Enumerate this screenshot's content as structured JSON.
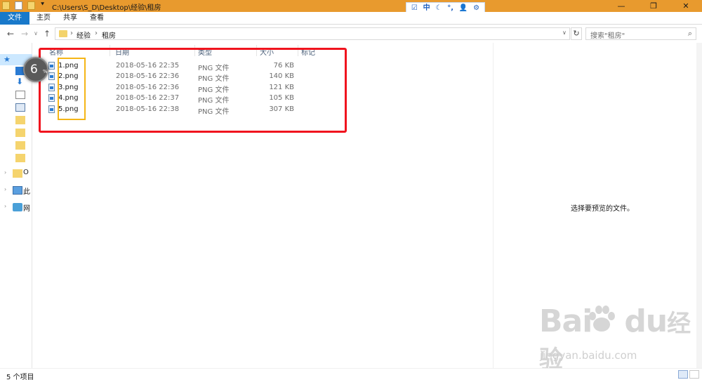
{
  "window": {
    "title": "C:\\Users\\S_D\\Desktop\\经验\\租房",
    "controls": {
      "minimize": "—",
      "restore": "❐",
      "close": "✕"
    }
  },
  "ime": {
    "items": [
      "☑",
      "中",
      "☾",
      "°,",
      "👤",
      "⚙"
    ]
  },
  "ribbon": {
    "tabs": [
      "文件",
      "主页",
      "共享",
      "查看"
    ]
  },
  "nav": {
    "back": "←",
    "forward": "→",
    "dropdown": "∨",
    "up": "↑",
    "breadcrumb": [
      "经验",
      "租房"
    ],
    "separator": "›",
    "address_dropdown": "∨",
    "refresh": "↻",
    "search_placeholder": "搜索\"租房\"",
    "search_icon": "⌕"
  },
  "navpane": {
    "labels": [
      "O",
      "此",
      "网"
    ]
  },
  "columns": [
    "名称",
    "日期",
    "类型",
    "大小",
    "标记"
  ],
  "files": [
    {
      "name": "1.png",
      "date": "2018-05-16 22:35",
      "type": "PNG 文件",
      "size": "76 KB"
    },
    {
      "name": "2.png",
      "date": "2018-05-16 22:36",
      "type": "PNG 文件",
      "size": "140 KB"
    },
    {
      "name": "3.png",
      "date": "2018-05-16 22:36",
      "type": "PNG 文件",
      "size": "121 KB"
    },
    {
      "name": "4.png",
      "date": "2018-05-16 22:37",
      "type": "PNG 文件",
      "size": "105 KB"
    },
    {
      "name": "5.png",
      "date": "2018-05-16 22:38",
      "type": "PNG 文件",
      "size": "307 KB"
    }
  ],
  "annotation": {
    "step": "6",
    "suffix": "%"
  },
  "preview": {
    "empty_text": "选择要预览的文件。"
  },
  "status": {
    "item_count": "5 个项目"
  },
  "watermark": {
    "main": "Bai",
    "main2": "du",
    "cn": "经验",
    "sub": "jingyan.baidu.com"
  },
  "colors": {
    "titlebar": "#e89a2e",
    "file_tab": "#1979ca",
    "highlight_red": "#f0141e",
    "highlight_yellow": "#f5b617"
  }
}
